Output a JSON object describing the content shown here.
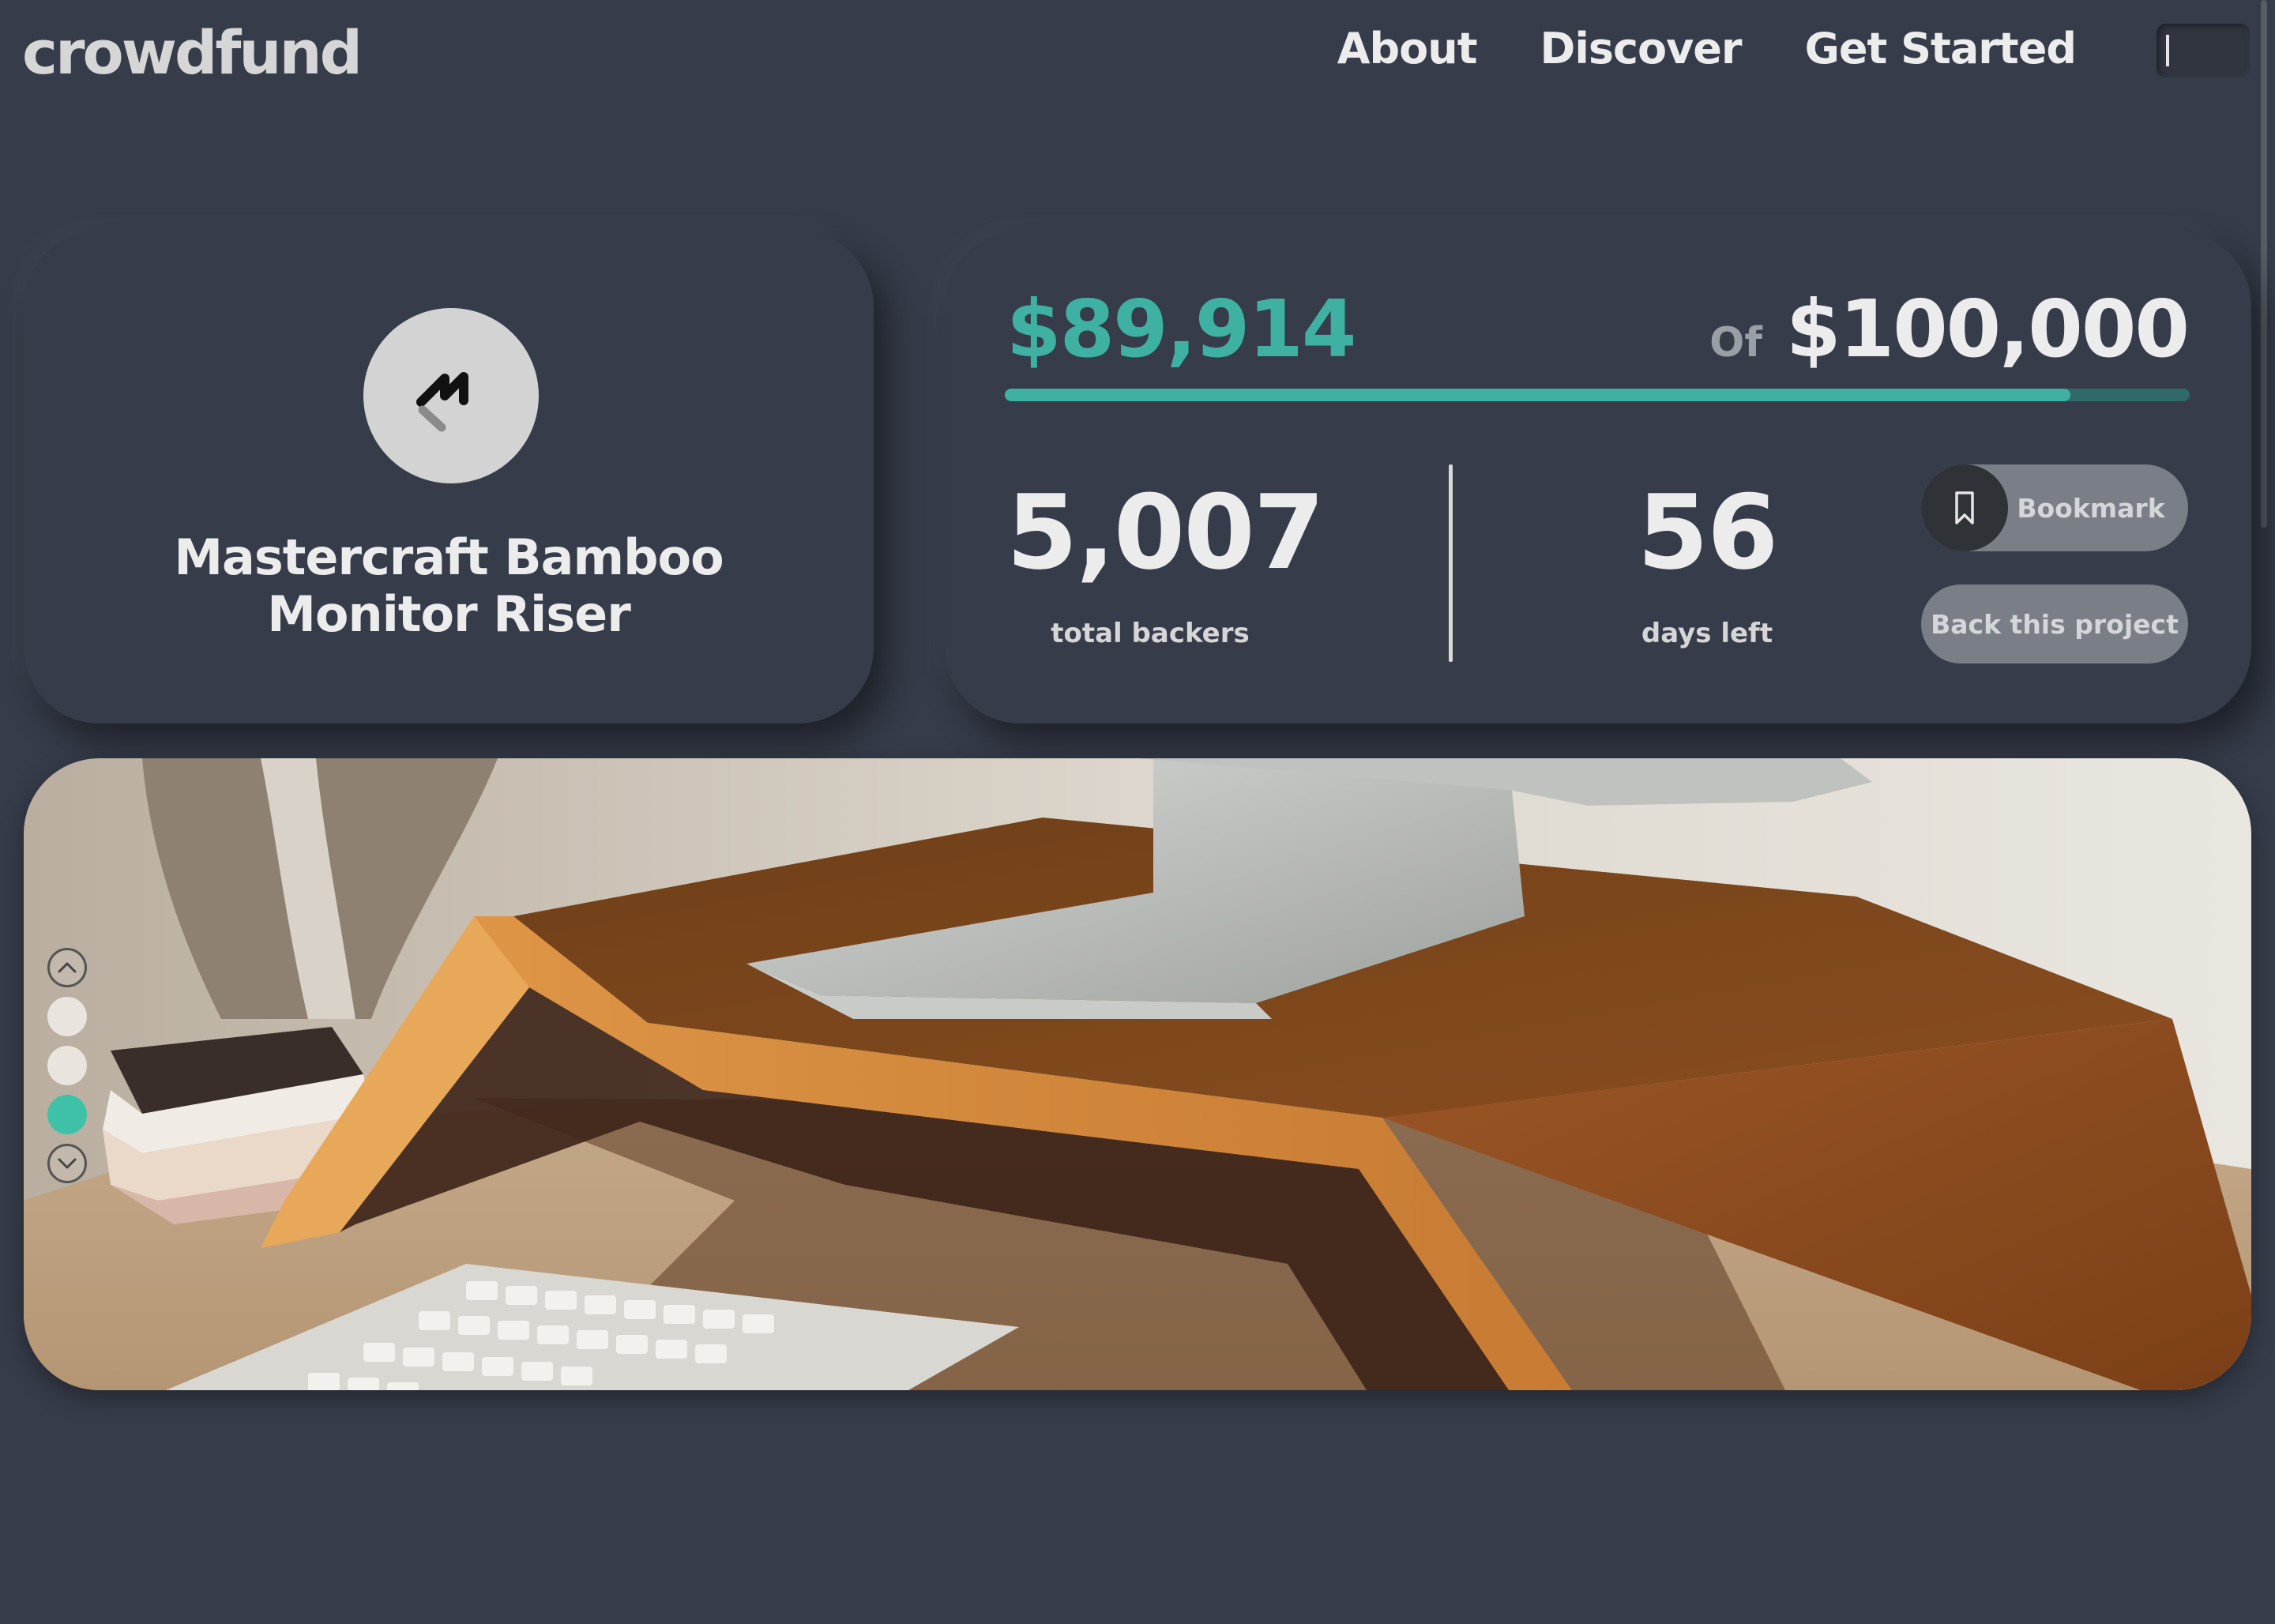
{
  "brand": {
    "name": "crowdfund"
  },
  "nav": {
    "items": [
      "About",
      "Discover",
      "Get Started"
    ]
  },
  "project": {
    "logo_icon": "mastercraft-m-logo-icon",
    "title_line1": "Mastercraft Bamboo",
    "title_line2": "Monitor Riser"
  },
  "funding": {
    "raised": "$89,914",
    "of_label": "Of",
    "goal": "$100,000",
    "progress_fraction": 0.89914,
    "accent_color": "#3fb1a2"
  },
  "stats": {
    "backers": "5,007",
    "backers_label": "total backers",
    "days": "56",
    "days_label": "days left"
  },
  "actions": {
    "bookmark_label": "Bookmark",
    "bookmark_icon": "bookmark-icon",
    "back_label": "Back this project"
  },
  "carousel": {
    "slide_count": 3,
    "active_index": 2,
    "up_icon": "chevron-up-icon",
    "down_icon": "chevron-down-icon"
  }
}
